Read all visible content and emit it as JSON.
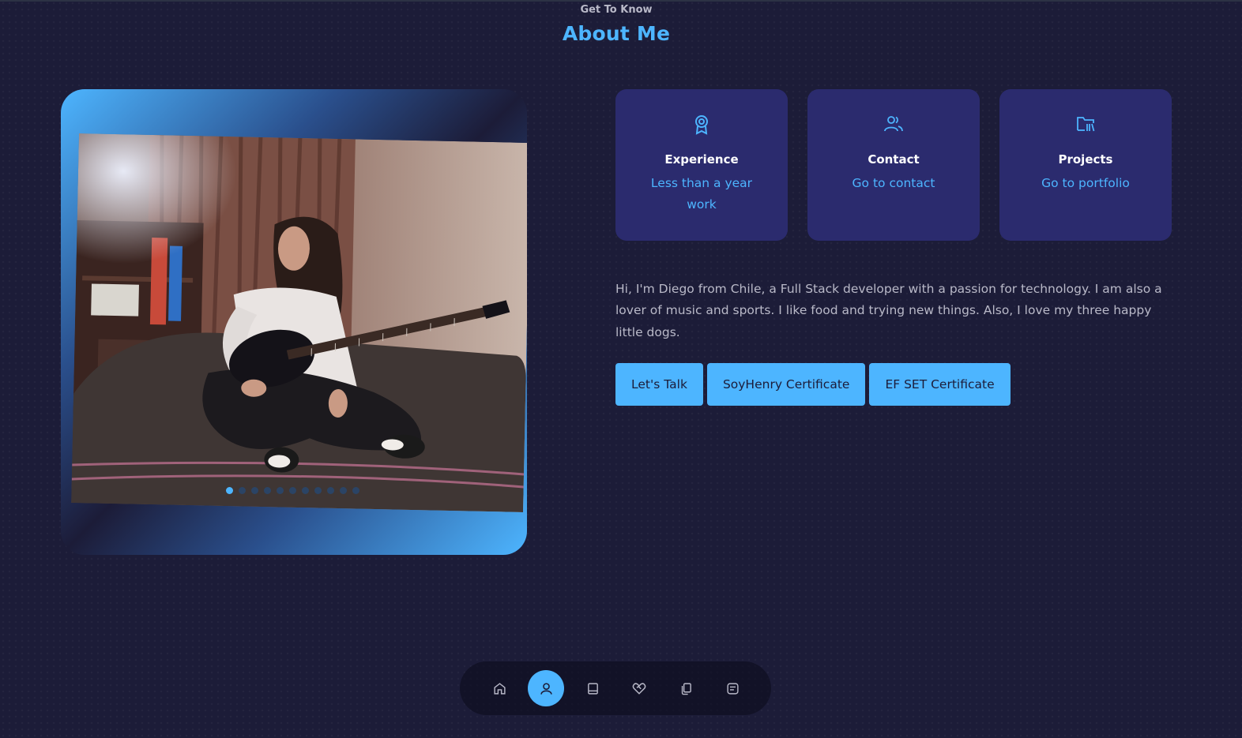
{
  "header": {
    "subtitle": "Get To Know",
    "title": "About Me"
  },
  "photo": {
    "alt": "Man with long hair sitting on a sofa holding an electric guitar",
    "slides": 11,
    "active_slide": 1
  },
  "cards": [
    {
      "icon": "award-icon",
      "title": "Experience",
      "link": "Less than a year work"
    },
    {
      "icon": "users-icon",
      "title": "Contact",
      "link": "Go to contact"
    },
    {
      "icon": "folder-library-icon",
      "title": "Projects",
      "link": "Go to portfolio"
    }
  ],
  "bio": "Hi, I'm Diego from Chile, a Full Stack developer with a passion for technology. I am also a lover of music and sports. I like food and trying new things. Also, I love my three happy little dogs.",
  "buttons": [
    {
      "label": "Let's Talk"
    },
    {
      "label": "SoyHenry Certificate"
    },
    {
      "label": "EF SET Certificate"
    }
  ],
  "nav": {
    "active": "about",
    "items": [
      {
        "id": "home",
        "icon": "home-icon"
      },
      {
        "id": "about",
        "icon": "user-icon"
      },
      {
        "id": "experience",
        "icon": "book-icon"
      },
      {
        "id": "services",
        "icon": "handshake-heart-icon"
      },
      {
        "id": "portfolio",
        "icon": "copy-icon"
      },
      {
        "id": "contact",
        "icon": "message-icon"
      }
    ]
  },
  "colors": {
    "background": "#1c1c38",
    "accent": "#4db5ff",
    "card": "#2b2b6e",
    "text_muted": "#b9b9c8"
  }
}
